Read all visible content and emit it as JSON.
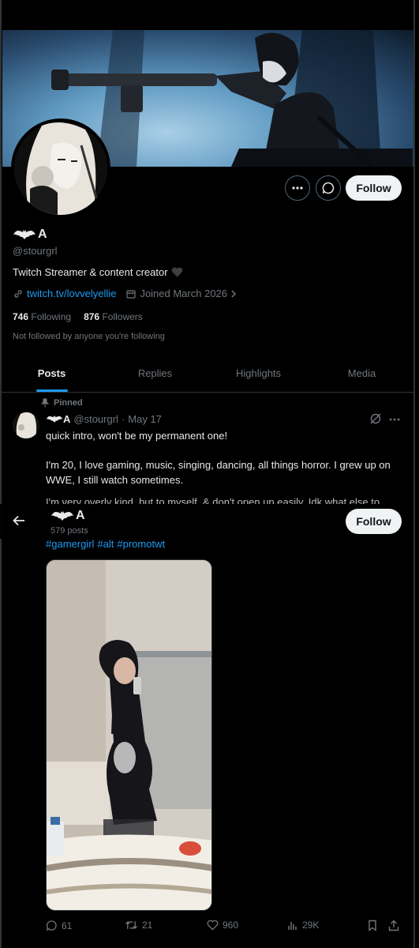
{
  "profile": {
    "display_name": "A",
    "handle": "@stourgrl",
    "bio": "Twitch Streamer & content creator",
    "website": "twitch.tv/lovvelyellie",
    "joined": "Joined March 2026",
    "following_count": "746",
    "following_label": "Following",
    "followers_count": "876",
    "followers_label": "Followers",
    "not_followed": "Not followed by anyone you're following",
    "follow_label": "Follow"
  },
  "tabs": [
    {
      "label": "Posts",
      "active": true
    },
    {
      "label": "Replies",
      "active": false
    },
    {
      "label": "Highlights",
      "active": false
    },
    {
      "label": "Media",
      "active": false
    }
  ],
  "post": {
    "pinned_label": "Pinned",
    "author_name": "A",
    "author_handle": "@stourgrl",
    "date": "May 17",
    "line1": "quick intro, won't be my permanent one!",
    "line2": "I'm 20, I love gaming, music, singing, dancing, all things horror. I grew up on WWE, I still watch sometimes.",
    "line3": "I'm very overly kind, but to myself, & don't open up easily. Idk what else to",
    "hashtags": [
      "#gamergirl",
      "#alt",
      "#promotwt"
    ],
    "replies": "61",
    "reposts": "21",
    "likes": "960",
    "views": "29K"
  },
  "sticky": {
    "name": "A",
    "posts_count": "579 posts",
    "follow_label": "Follow"
  },
  "colors": {
    "background": "#000000",
    "accent": "#1d9bf0",
    "muted": "#71767b",
    "text": "#e7e9ea"
  },
  "icons": [
    "bat-icon",
    "more-icon",
    "message-icon",
    "link-icon",
    "calendar-icon",
    "chevron-right-icon",
    "pin-icon",
    "grok-icon",
    "back-arrow-icon",
    "reply-icon",
    "repost-icon",
    "like-icon",
    "views-icon",
    "bookmark-icon",
    "share-icon"
  ]
}
